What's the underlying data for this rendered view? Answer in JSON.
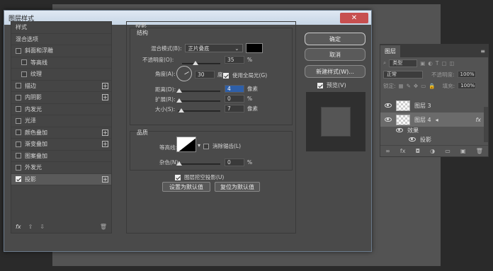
{
  "dialog": {
    "title": "图层样式",
    "close": "✕"
  },
  "left_list": {
    "items": [
      {
        "label": "样式",
        "checkbox": false,
        "indent": false,
        "plus": false,
        "checked": false
      },
      {
        "label": "混合选项",
        "checkbox": false,
        "indent": false,
        "plus": false,
        "checked": false
      },
      {
        "label": "斜面和浮雕",
        "checkbox": true,
        "indent": false,
        "plus": false,
        "checked": false
      },
      {
        "label": "等高线",
        "checkbox": true,
        "indent": true,
        "plus": false,
        "checked": false
      },
      {
        "label": "纹理",
        "checkbox": true,
        "indent": true,
        "plus": false,
        "checked": false
      },
      {
        "label": "描边",
        "checkbox": true,
        "indent": false,
        "plus": true,
        "checked": false
      },
      {
        "label": "内阴影",
        "checkbox": true,
        "indent": false,
        "plus": true,
        "checked": false
      },
      {
        "label": "内发光",
        "checkbox": true,
        "indent": false,
        "plus": false,
        "checked": false
      },
      {
        "label": "光泽",
        "checkbox": true,
        "indent": false,
        "plus": false,
        "checked": false
      },
      {
        "label": "颜色叠加",
        "checkbox": true,
        "indent": false,
        "plus": true,
        "checked": false
      },
      {
        "label": "渐变叠加",
        "checkbox": true,
        "indent": false,
        "plus": true,
        "checked": false
      },
      {
        "label": "图案叠加",
        "checkbox": true,
        "indent": false,
        "plus": false,
        "checked": false
      },
      {
        "label": "外发光",
        "checkbox": true,
        "indent": false,
        "plus": false,
        "checked": false
      },
      {
        "label": "投影",
        "checkbox": true,
        "indent": false,
        "plus": true,
        "checked": true
      }
    ],
    "footer": {
      "fx": "fx",
      "up": "⇧",
      "down": "⇩",
      "trash": "🗑"
    }
  },
  "drop_shadow": {
    "title": "投影",
    "structure_title": "结构",
    "blend_mode_label": "混合模式(B):",
    "blend_mode_value": "正片叠底",
    "opacity_label": "不透明度(O):",
    "opacity_value": "35",
    "opacity_unit": "%",
    "opacity_level": 0.35,
    "angle_label": "角度(A):",
    "angle_value": "30",
    "angle_unit": "度",
    "global_light_label": "使用全局光(G)",
    "distance_label": "距离(D):",
    "distance_value": "4",
    "distance_unit": "像素",
    "spread_label": "扩展(R):",
    "spread_value": "0",
    "spread_unit": "%",
    "size_label": "大小(S):",
    "size_value": "7",
    "size_unit": "像素",
    "quality_title": "品质",
    "contour_label": "等高线:",
    "antialias_label": "消除锯齿(L)",
    "noise_label": "杂色(N):",
    "noise_value": "0",
    "noise_unit": "%",
    "knockout_label": "图层挖空投影(U)",
    "make_default": "设置为默认值",
    "reset_default": "复位为默认值",
    "shadow_color": "#000000"
  },
  "right_buttons": {
    "ok": "确定",
    "cancel": "取消",
    "new_style": "新建样式(W)...",
    "preview_label": "预览(V)"
  },
  "layers_panel": {
    "tab": "图层",
    "kind": "类型",
    "blend": "正常",
    "opacity_label": "不透明度:",
    "opacity_value": "100%",
    "lock_label": "锁定:",
    "fill_label": "填充:",
    "fill_value": "100%",
    "layers": [
      {
        "name": "图层 3"
      },
      {
        "name": "图层 4",
        "fx": "fx"
      }
    ],
    "effects_label": "效果",
    "effect_item": "投影",
    "footer_icons": [
      "∞",
      "fx",
      "◘",
      "◑",
      "▭",
      "▣",
      "🗑"
    ]
  }
}
